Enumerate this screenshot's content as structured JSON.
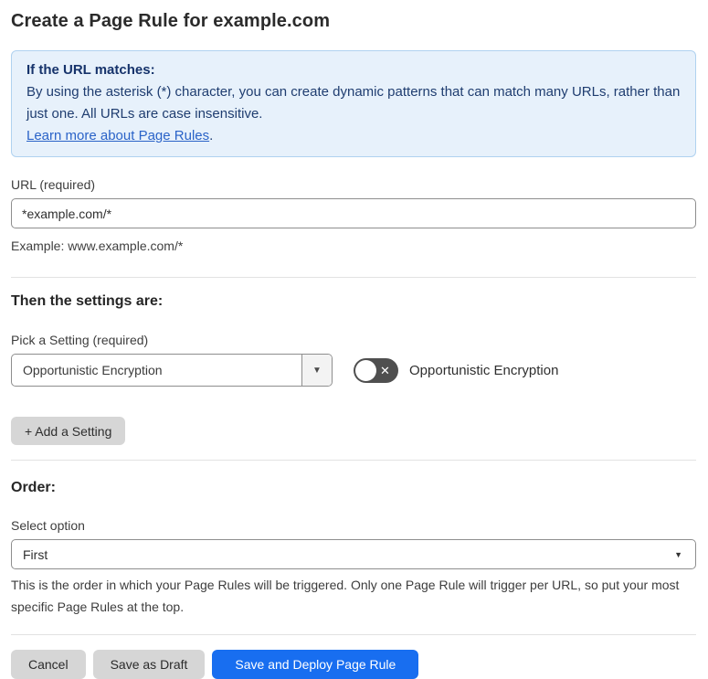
{
  "page": {
    "title": "Create a Page Rule for example.com"
  },
  "info_box": {
    "heading": "If the URL matches:",
    "body": "By using the asterisk (*) character, you can create dynamic patterns that can match many URLs, rather than just one. All URLs are case insensitive.",
    "link_label": "Learn more about Page Rules",
    "link_suffix": "."
  },
  "url_field": {
    "label": "URL (required)",
    "value": "*example.com/*",
    "example": "Example: www.example.com/*"
  },
  "settings_section": {
    "heading": "Then the settings are:",
    "pick_label": "Pick a Setting (required)",
    "selected_setting": "Opportunistic Encryption",
    "toggle_state": "off",
    "toggle_label": "Opportunistic Encryption",
    "add_button_label": "+ Add a Setting"
  },
  "order_section": {
    "heading": "Order:",
    "select_label": "Select option",
    "selected_option": "First",
    "help": "This is the order in which your Page Rules will be triggered. Only one Page Rule will trigger per URL, so put your most specific Page Rules at the top."
  },
  "footer": {
    "cancel_label": "Cancel",
    "save_draft_label": "Save as Draft",
    "save_deploy_label": "Save and Deploy Page Rule"
  },
  "icons": {
    "dropdown_arrow": "▼",
    "select_arrow": "▼",
    "toggle_x": "✕"
  },
  "colors": {
    "info_bg": "#e7f1fb",
    "info_border": "#b0d2f0",
    "info_text": "#1f3d70",
    "link": "#2a63c8",
    "primary_button": "#186ef0",
    "secondary_button": "#d6d6d6",
    "toggle_off": "#4f4f4f"
  }
}
